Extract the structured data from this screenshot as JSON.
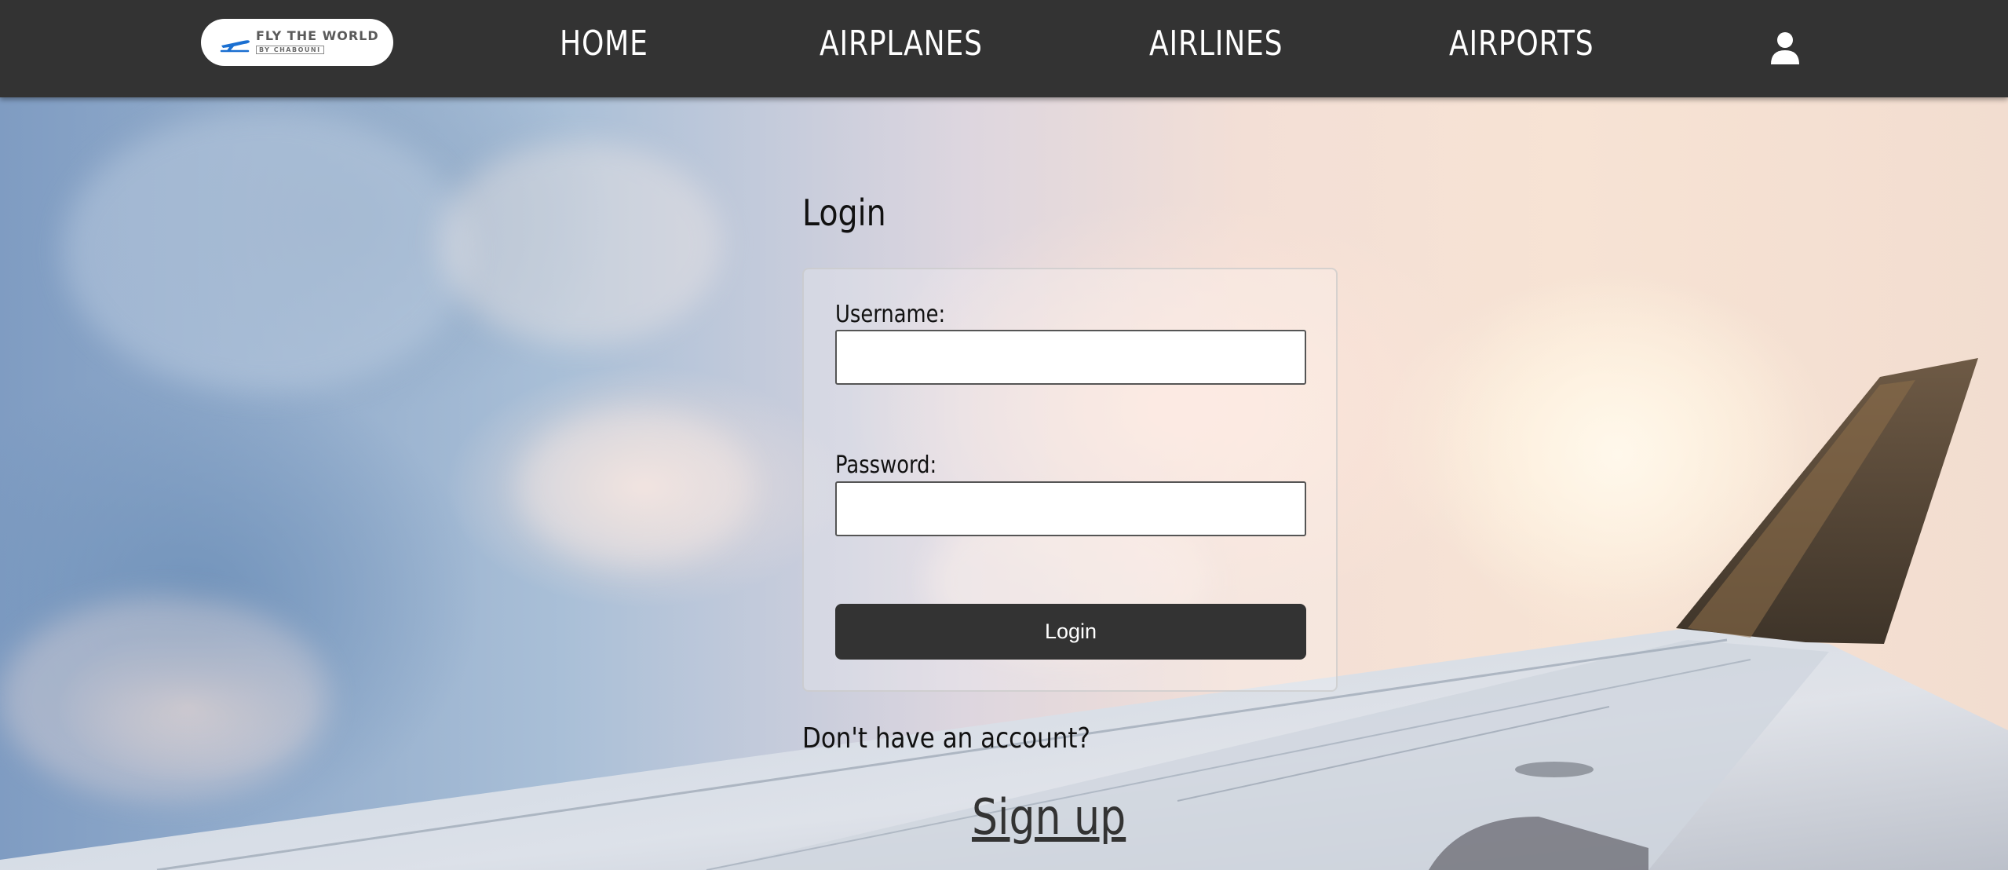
{
  "brand": {
    "logo_title": "FLY THE WORLD",
    "logo_subtitle": "BY CHABOUNI",
    "accent_color": "#1a6fd1"
  },
  "nav": {
    "items": [
      {
        "label": "HOME"
      },
      {
        "label": "AIRPLANES"
      },
      {
        "label": "AIRLINES"
      },
      {
        "label": "AIRPORTS"
      }
    ],
    "user_icon": "user-icon",
    "background_color": "#333333"
  },
  "login": {
    "title": "Login",
    "username_label": "Username:",
    "username_value": "",
    "password_label": "Password:",
    "password_value": "",
    "submit_label": "Login",
    "no_account_text": "Don't have an account?",
    "signup_label": "Sign up"
  }
}
